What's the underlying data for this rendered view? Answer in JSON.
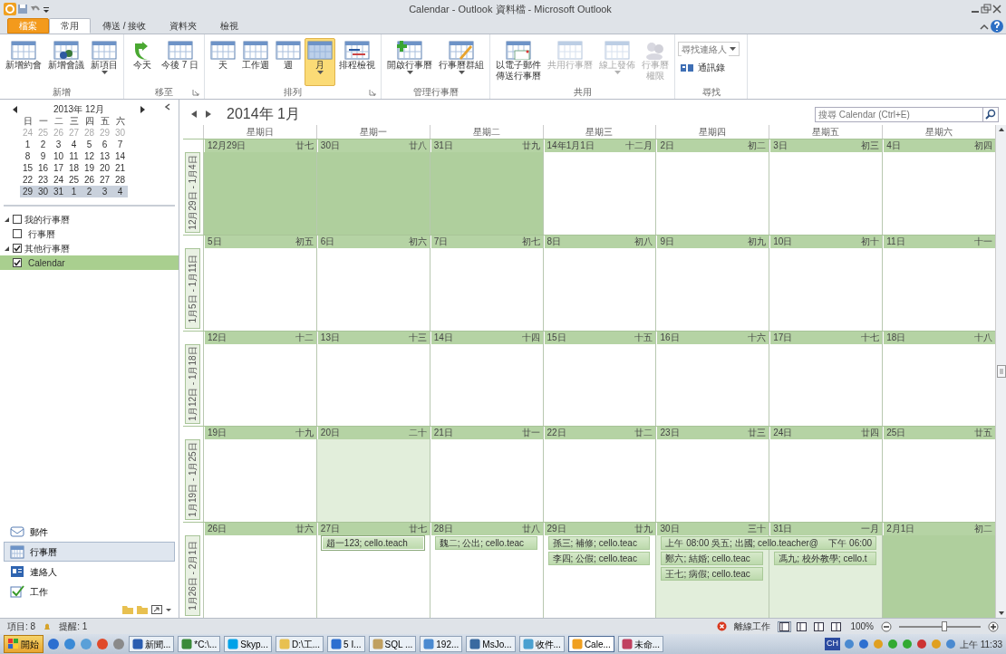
{
  "window": {
    "title": "Calendar - Outlook 資料檔 - Microsoft Outlook"
  },
  "ribbon_tabs": [
    {
      "label": "檔案",
      "kind": "file",
      "selected": false
    },
    {
      "label": "常用",
      "kind": "tab",
      "selected": true
    },
    {
      "label": "傳送 / 接收",
      "kind": "tab",
      "selected": false
    },
    {
      "label": "資料夾",
      "kind": "tab",
      "selected": false
    },
    {
      "label": "檢視",
      "kind": "tab",
      "selected": false
    }
  ],
  "ribbon_groups": [
    {
      "label": "新增",
      "kind": "buttons",
      "launcher": false,
      "buttons": [
        {
          "lines": [
            "新增約會"
          ],
          "dropdown": false,
          "disabled": false,
          "selected": false
        },
        {
          "lines": [
            "新增會議"
          ],
          "dropdown": false,
          "disabled": false,
          "selected": false
        },
        {
          "lines": [
            "新項目"
          ],
          "dropdown": true,
          "disabled": false,
          "selected": false
        }
      ]
    },
    {
      "label": "移至",
      "kind": "buttons",
      "launcher": true,
      "buttons": [
        {
          "lines": [
            "今天"
          ],
          "dropdown": false,
          "disabled": false,
          "selected": false
        },
        {
          "lines": [
            "今後 7 日"
          ],
          "dropdown": false,
          "disabled": false,
          "selected": false
        }
      ]
    },
    {
      "label": "排列",
      "kind": "buttons",
      "launcher": true,
      "buttons": [
        {
          "lines": [
            "天"
          ],
          "dropdown": false,
          "disabled": false,
          "selected": false
        },
        {
          "lines": [
            "工作週"
          ],
          "dropdown": false,
          "disabled": false,
          "selected": false
        },
        {
          "lines": [
            "週"
          ],
          "dropdown": false,
          "disabled": false,
          "selected": false
        },
        {
          "lines": [
            "月"
          ],
          "dropdown": true,
          "disabled": false,
          "selected": true
        },
        {
          "lines": [
            "排程檢視"
          ],
          "dropdown": false,
          "disabled": false,
          "selected": false
        }
      ]
    },
    {
      "label": "管理行事曆",
      "kind": "buttons",
      "launcher": false,
      "buttons": [
        {
          "lines": [
            "開啟行事曆"
          ],
          "dropdown": true,
          "disabled": false,
          "selected": false
        },
        {
          "lines": [
            "行事曆群組"
          ],
          "dropdown": true,
          "disabled": false,
          "selected": false
        }
      ]
    },
    {
      "label": "共用",
      "kind": "buttons",
      "launcher": false,
      "buttons": [
        {
          "lines": [
            "以電子郵件",
            "傳送行事曆"
          ],
          "dropdown": false,
          "disabled": false,
          "selected": false
        },
        {
          "lines": [
            "共用行事曆"
          ],
          "dropdown": false,
          "disabled": true,
          "selected": false
        },
        {
          "lines": [
            "線上發佈"
          ],
          "dropdown": true,
          "disabled": true,
          "selected": false
        },
        {
          "lines": [
            "行事曆",
            "權限"
          ],
          "dropdown": false,
          "disabled": true,
          "selected": false
        }
      ]
    },
    {
      "label": "尋找",
      "kind": "find",
      "launcher": false,
      "field": {
        "placeholder": "尋找連絡人"
      },
      "links": [
        "通訊錄"
      ]
    }
  ],
  "mini_calendar": {
    "title": "2013年 12月",
    "weekdays": [
      "日",
      "一",
      "二",
      "三",
      "四",
      "五",
      "六"
    ],
    "weeks": [
      {
        "days": [
          "24",
          "25",
          "26",
          "27",
          "28",
          "29",
          "30"
        ],
        "dim": true,
        "selected": false
      },
      {
        "days": [
          "1",
          "2",
          "3",
          "4",
          "5",
          "6",
          "7"
        ],
        "dim": false,
        "selected": false
      },
      {
        "days": [
          "8",
          "9",
          "10",
          "11",
          "12",
          "13",
          "14"
        ],
        "dim": false,
        "selected": false
      },
      {
        "days": [
          "15",
          "16",
          "17",
          "18",
          "19",
          "20",
          "21"
        ],
        "dim": false,
        "selected": false
      },
      {
        "days": [
          "22",
          "23",
          "24",
          "25",
          "26",
          "27",
          "28"
        ],
        "dim": false,
        "selected": false
      },
      {
        "days": [
          "29",
          "30",
          "31",
          "1",
          "2",
          "3",
          "4"
        ],
        "dim": false,
        "selected": true
      }
    ]
  },
  "folders": [
    {
      "label": "我的行事曆",
      "checked": false,
      "expanded": true,
      "selected": false,
      "children": [
        {
          "label": "行事曆",
          "checked": false,
          "selected": false
        }
      ]
    },
    {
      "label": "其他行事曆",
      "checked": true,
      "expanded": true,
      "selected": false,
      "children": [
        {
          "label": "Calendar",
          "checked": true,
          "selected": true
        }
      ]
    }
  ],
  "nav_buttons": [
    {
      "label": "郵件",
      "selected": false
    },
    {
      "label": "行事曆",
      "selected": true
    },
    {
      "label": "連絡人",
      "selected": false
    },
    {
      "label": "工作",
      "selected": false
    }
  ],
  "calendar": {
    "title": "2014年 1月",
    "search": {
      "placeholder": "搜尋 Calendar (Ctrl+E)"
    },
    "weekdays": [
      "星期日",
      "星期一",
      "星期二",
      "星期三",
      "星期四",
      "星期五",
      "星期六"
    ],
    "weeks": [
      {
        "label": "12月29日 - 1月4日",
        "days": [
          {
            "date": "12月29日",
            "lunar": "廿七",
            "outside_month": true,
            "highlighted": false
          },
          {
            "date": "30日",
            "lunar": "廿八",
            "outside_month": true,
            "highlighted": false
          },
          {
            "date": "31日",
            "lunar": "廿九",
            "outside_month": true,
            "highlighted": false
          },
          {
            "date": "14年1月1日",
            "lunar": "十二月",
            "outside_month": false,
            "highlighted": false
          },
          {
            "date": "2日",
            "lunar": "初二",
            "outside_month": false,
            "highlighted": false
          },
          {
            "date": "3日",
            "lunar": "初三",
            "outside_month": false,
            "highlighted": false
          },
          {
            "date": "4日",
            "lunar": "初四",
            "outside_month": false,
            "highlighted": false
          }
        ]
      },
      {
        "label": "1月5日 - 1月11日",
        "days": [
          {
            "date": "5日",
            "lunar": "初五",
            "outside_month": false,
            "highlighted": false
          },
          {
            "date": "6日",
            "lunar": "初六",
            "outside_month": false,
            "highlighted": false
          },
          {
            "date": "7日",
            "lunar": "初七",
            "outside_month": false,
            "highlighted": false
          },
          {
            "date": "8日",
            "lunar": "初八",
            "outside_month": false,
            "highlighted": false
          },
          {
            "date": "9日",
            "lunar": "初九",
            "outside_month": false,
            "highlighted": false
          },
          {
            "date": "10日",
            "lunar": "初十",
            "outside_month": false,
            "highlighted": false
          },
          {
            "date": "11日",
            "lunar": "十一",
            "outside_month": false,
            "highlighted": false
          }
        ]
      },
      {
        "label": "1月12日 - 1月18日",
        "days": [
          {
            "date": "12日",
            "lunar": "十二",
            "outside_month": false,
            "highlighted": false
          },
          {
            "date": "13日",
            "lunar": "十三",
            "outside_month": false,
            "highlighted": false
          },
          {
            "date": "14日",
            "lunar": "十四",
            "outside_month": false,
            "highlighted": false
          },
          {
            "date": "15日",
            "lunar": "十五",
            "outside_month": false,
            "highlighted": false
          },
          {
            "date": "16日",
            "lunar": "十六",
            "outside_month": false,
            "highlighted": false
          },
          {
            "date": "17日",
            "lunar": "十七",
            "outside_month": false,
            "highlighted": false
          },
          {
            "date": "18日",
            "lunar": "十八",
            "outside_month": false,
            "highlighted": false
          }
        ]
      },
      {
        "label": "1月19日 - 1月25日",
        "days": [
          {
            "date": "19日",
            "lunar": "十九",
            "outside_month": false,
            "highlighted": false
          },
          {
            "date": "20日",
            "lunar": "二十",
            "outside_month": false,
            "highlighted": true
          },
          {
            "date": "21日",
            "lunar": "廿一",
            "outside_month": false,
            "highlighted": false
          },
          {
            "date": "22日",
            "lunar": "廿二",
            "outside_month": false,
            "highlighted": false
          },
          {
            "date": "23日",
            "lunar": "廿三",
            "outside_month": false,
            "highlighted": false
          },
          {
            "date": "24日",
            "lunar": "廿四",
            "outside_month": false,
            "highlighted": false
          },
          {
            "date": "25日",
            "lunar": "廿五",
            "outside_month": false,
            "highlighted": false
          }
        ]
      },
      {
        "label": "1月26日 - 2月1日",
        "days": [
          {
            "date": "26日",
            "lunar": "廿六",
            "outside_month": false,
            "highlighted": false
          },
          {
            "date": "27日",
            "lunar": "廿七",
            "outside_month": false,
            "highlighted": false,
            "events": [
              {
                "text": "趙一123; cello.teach",
                "kind": "single",
                "selected": true
              }
            ]
          },
          {
            "date": "28日",
            "lunar": "廿八",
            "outside_month": false,
            "highlighted": false,
            "events": [
              {
                "text": "魏二; 公出; cello.teac",
                "kind": "single",
                "selected": false
              }
            ]
          },
          {
            "date": "29日",
            "lunar": "廿九",
            "outside_month": false,
            "highlighted": false,
            "events": [
              {
                "text": "孫三; 補修; cello.teac",
                "kind": "single",
                "selected": false
              },
              {
                "text": "李四; 公假; cello.teac",
                "kind": "single",
                "selected": false
              }
            ]
          },
          {
            "date": "30日",
            "lunar": "三十",
            "outside_month": false,
            "highlighted": true,
            "events": [
              {
                "text": "上午 08:00 吳五; 出國; cello.teacher@",
                "end": "下午 06:00",
                "kind": "multi_day",
                "selected": false
              },
              {
                "text": "鄭六; 結婚; cello.teac",
                "kind": "single",
                "selected": false
              },
              {
                "text": "王七; 病假; cello.teac",
                "kind": "single",
                "selected": false
              }
            ]
          },
          {
            "date": "31日",
            "lunar": "一月",
            "outside_month": false,
            "highlighted": true,
            "events": [
              {
                "text": "馮九; 校外教學; cello.t",
                "kind": "single",
                "selected": false
              }
            ]
          },
          {
            "date": "2月1日",
            "lunar": "初二",
            "outside_month": true,
            "highlighted": false
          }
        ]
      }
    ]
  },
  "status_bar": {
    "items": "項目: 8",
    "reminders": "提醒: 1",
    "offline": "離線工作",
    "views": [
      {
        "selected": true
      },
      {
        "selected": false
      },
      {
        "selected": false
      },
      {
        "selected": false
      }
    ],
    "zoom": "100%",
    "zoom_slider": {
      "level": 0.55
    }
  },
  "taskbar": {
    "start": "開始",
    "tasks": [
      {
        "label": "新聞...",
        "selected": false
      },
      {
        "label": "*C:\\...",
        "selected": false
      },
      {
        "label": "Skyp...",
        "selected": false
      },
      {
        "label": "D:\\工...",
        "selected": false
      },
      {
        "label": "5 I...",
        "selected": false
      },
      {
        "label": "SQL ...",
        "selected": false
      },
      {
        "label": "192...",
        "selected": false
      },
      {
        "label": "MsJo...",
        "selected": false
      },
      {
        "label": "收件...",
        "selected": false
      },
      {
        "label": "Cale...",
        "selected": true
      },
      {
        "label": "未命...",
        "selected": false
      }
    ],
    "ime": "CH",
    "time": "上午 11:33"
  }
}
